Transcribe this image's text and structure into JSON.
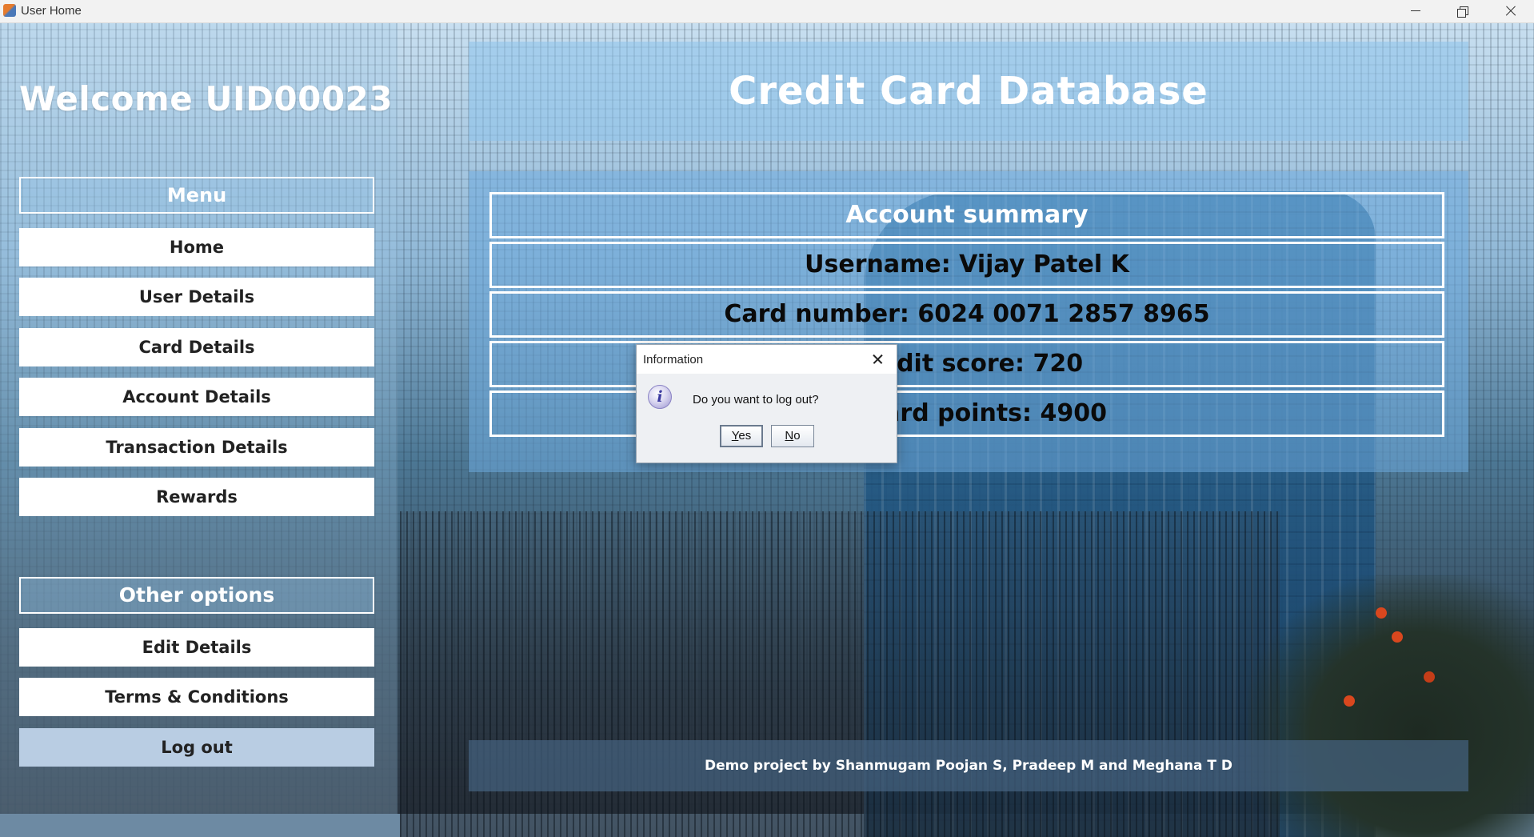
{
  "window": {
    "title": "User Home"
  },
  "sidebar": {
    "welcome": "Welcome UID00023",
    "menu_header": "Menu",
    "menu_items": [
      {
        "label": "Home"
      },
      {
        "label": "User Details"
      },
      {
        "label": "Card Details"
      },
      {
        "label": "Account Details"
      },
      {
        "label": "Transaction Details"
      },
      {
        "label": "Rewards"
      }
    ],
    "other_header": "Other options",
    "other_items": [
      {
        "label": "Edit Details"
      },
      {
        "label": "Terms & Conditions"
      },
      {
        "label": "Log out"
      }
    ]
  },
  "header": {
    "title": "Credit Card Database"
  },
  "summary": {
    "heading": "Account summary",
    "rows": [
      "Username: Vijay Patel K",
      "Card number: 6024 0071 2857 8965",
      "Credit score: 720",
      "Reward points: 4900"
    ]
  },
  "footer": {
    "text": "Demo project by Shanmugam Poojan S, Pradeep M and Meghana T D"
  },
  "dialog": {
    "title": "Information",
    "message": "Do you want to log out?",
    "icon": "info-icon",
    "yes_first": "Y",
    "yes_rest": "es",
    "no_first": "N",
    "no_rest": "o"
  },
  "colors": {
    "logout_button": "#b9cde3",
    "nav_button": "#ffffff",
    "panel": "#8cc3eb"
  }
}
